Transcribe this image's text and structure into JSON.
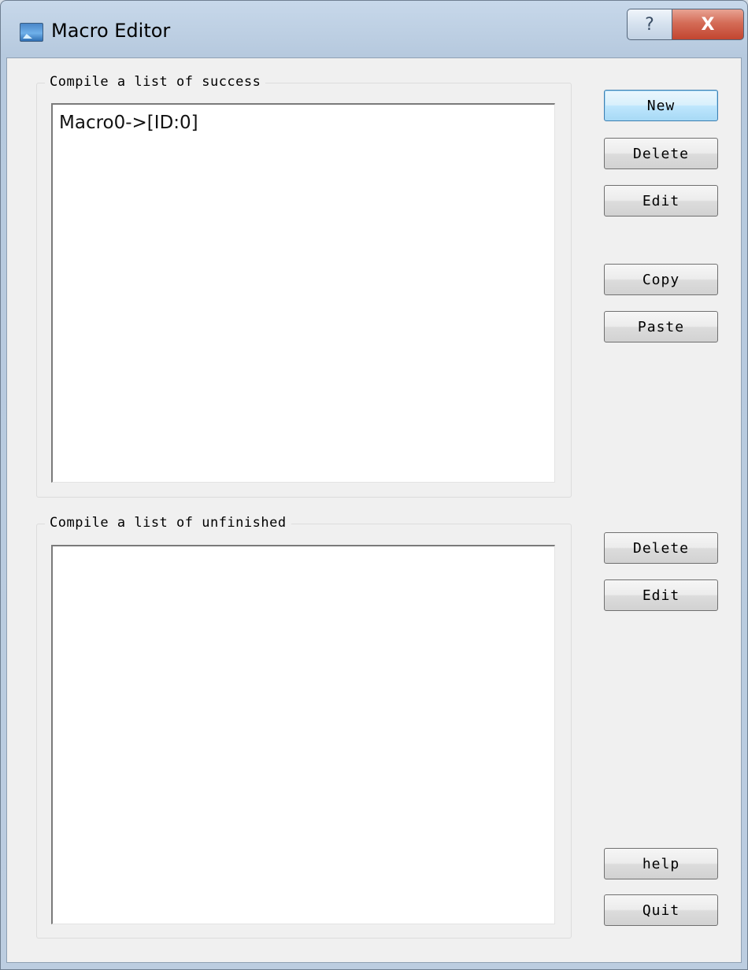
{
  "window": {
    "title": "Macro Editor"
  },
  "caption_buttons": {
    "help": "?",
    "close": "X"
  },
  "success_group": {
    "label": "Compile a list of success",
    "items": [
      "Macro0->[ID:0]"
    ]
  },
  "unfinished_group": {
    "label": "Compile a list of unfinished",
    "items": []
  },
  "buttons": {
    "new": "New",
    "delete_success": "Delete",
    "edit_success": "Edit",
    "copy": "Copy",
    "paste": "Paste",
    "delete_unfinished": "Delete",
    "edit_unfinished": "Edit",
    "help": "help",
    "quit": "Quit"
  }
}
